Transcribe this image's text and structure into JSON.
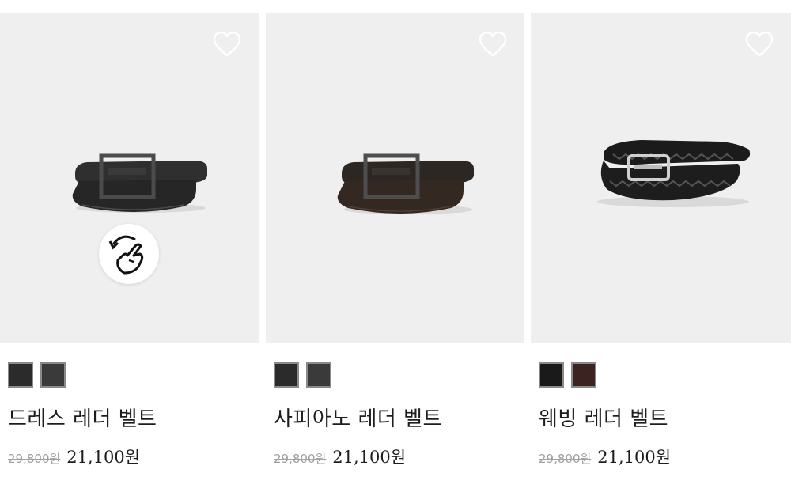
{
  "products": [
    {
      "name": "드레스 레더 벨트",
      "original_price": "29,800원",
      "sale_price": "21,100원",
      "swatches": [
        "#2b2b2b",
        "#3a3a3a"
      ],
      "image": "black-leather-belt-icon",
      "has_rotate_view": true
    },
    {
      "name": "사피아노 레더 벨트",
      "original_price": "29,800원",
      "sale_price": "21,100원",
      "swatches": [
        "#2b2b2b",
        "#3a3a3a"
      ],
      "image": "brown-leather-belt-icon",
      "has_rotate_view": false
    },
    {
      "name": "웨빙 레더 벨트",
      "original_price": "29,800원",
      "sale_price": "21,100원",
      "swatches": [
        "#1a1a1a",
        "#3a2320"
      ],
      "image": "braided-leather-belt-icon",
      "has_rotate_view": false
    }
  ],
  "colors": {
    "image_background": "#efefef",
    "strike_price": "#a0a0a0",
    "text": "#1d1d1d"
  }
}
